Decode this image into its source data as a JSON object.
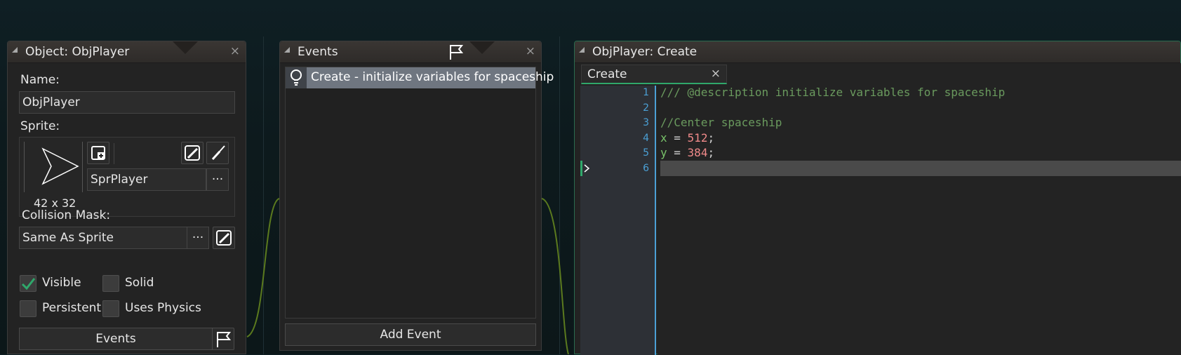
{
  "object_panel": {
    "title": "Object: ObjPlayer",
    "close": "×",
    "name_label": "Name:",
    "name_value": "ObjPlayer",
    "sprite_label": "Sprite:",
    "sprite_name": "SprPlayer",
    "sprite_size": "42 x 32",
    "browse": "···",
    "collision_label": "Collision Mask:",
    "collision_value": "Same As Sprite",
    "visible_label": "Visible",
    "solid_label": "Solid",
    "persistent_label": "Persistent",
    "physics_label": "Uses Physics",
    "visible_checked": true,
    "solid_checked": false,
    "persistent_checked": false,
    "physics_checked": false,
    "events_button": "Events"
  },
  "events_panel": {
    "title": "Events",
    "close": "×",
    "items": [
      {
        "label": "Create - initialize variables for spaceship"
      }
    ],
    "add_event": "Add Event"
  },
  "code_panel": {
    "title": "ObjPlayer: Create",
    "tab_label": "Create",
    "tab_close": "×",
    "lines": [
      {
        "n": "1",
        "text": "/// @description initialize variables for spaceship",
        "kind": "comment"
      },
      {
        "n": "2",
        "text": "",
        "kind": "blank"
      },
      {
        "n": "3",
        "text": "//Center spaceship",
        "kind": "comment"
      },
      {
        "n": "4",
        "var": "x",
        "op": " = ",
        "num": "512",
        "end": ";",
        "kind": "assign"
      },
      {
        "n": "5",
        "var": "y",
        "op": " = ",
        "num": "384",
        "end": ";",
        "kind": "assign"
      },
      {
        "n": "6",
        "text": "",
        "kind": "current"
      }
    ]
  },
  "colors": {
    "comment": "#6a9a5e",
    "variable": "#79c36a",
    "number": "#f08a8a",
    "line_number": "#4ba0d6",
    "accent": "#2fa86b"
  }
}
